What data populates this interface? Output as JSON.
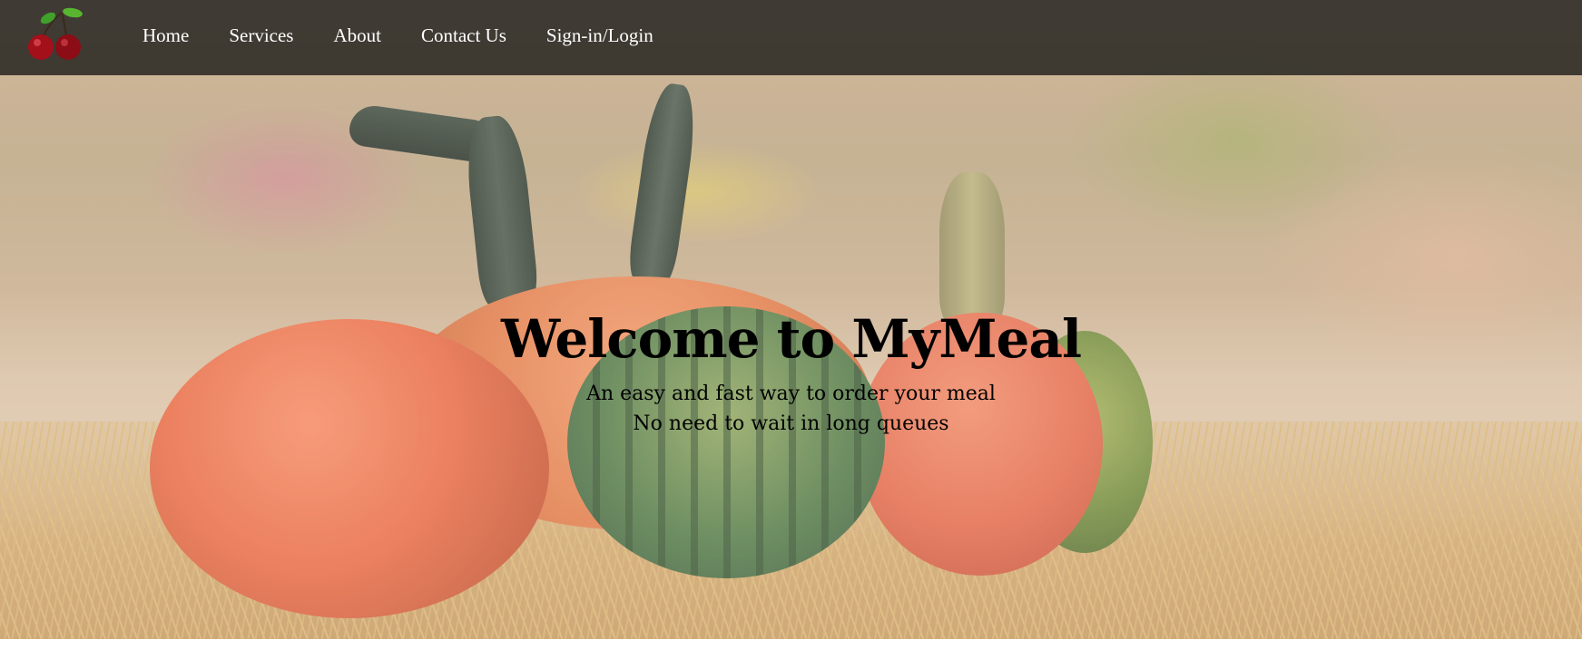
{
  "site": {
    "logo_icon": "cherries-icon"
  },
  "nav": {
    "items": [
      {
        "label": "Home"
      },
      {
        "label": "Services"
      },
      {
        "label": "About"
      },
      {
        "label": "Contact Us"
      },
      {
        "label": "Sign-in/Login"
      }
    ]
  },
  "hero": {
    "title": "Welcome to MyMeal",
    "subtitle_line1": "An easy and fast way to order your meal",
    "subtitle_line2": "No need to wait in long queues"
  },
  "colors": {
    "navbar_bg": "#1e1e1c",
    "nav_text": "#ffffff",
    "hero_text": "#000000"
  }
}
